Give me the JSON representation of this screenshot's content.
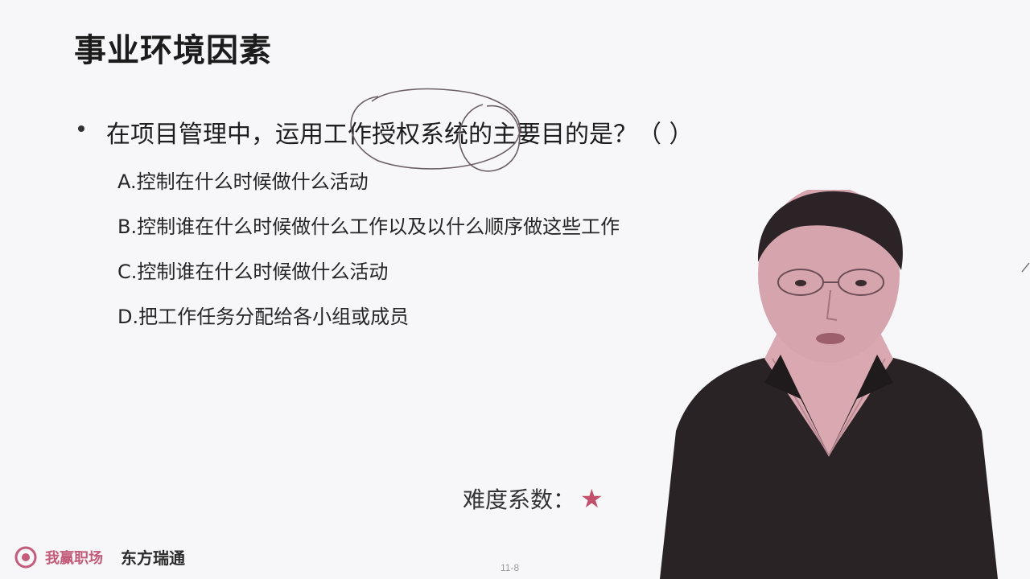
{
  "slide": {
    "title": "事业环境因素",
    "question": "在项目管理中，运用工作授权系统的主要目的是？（    ）",
    "options": [
      "A.控制在什么时候做什么活动",
      "B.控制谁在什么时候做什么工作以及以什么顺序做这些工作",
      "C.控制谁在什么时候做什么活动",
      "D.把工作任务分配给各小组或成员"
    ],
    "difficulty_label": "难度系数：",
    "difficulty_stars": 1,
    "page_number": "11-8"
  },
  "branding": {
    "logo1": "我赢职场",
    "logo2": "东方瑞通"
  },
  "colors": {
    "background": "#f7f7f9",
    "accent": "#c0506a",
    "suit": "#2a2325",
    "shirt": "#d9a8b0"
  }
}
